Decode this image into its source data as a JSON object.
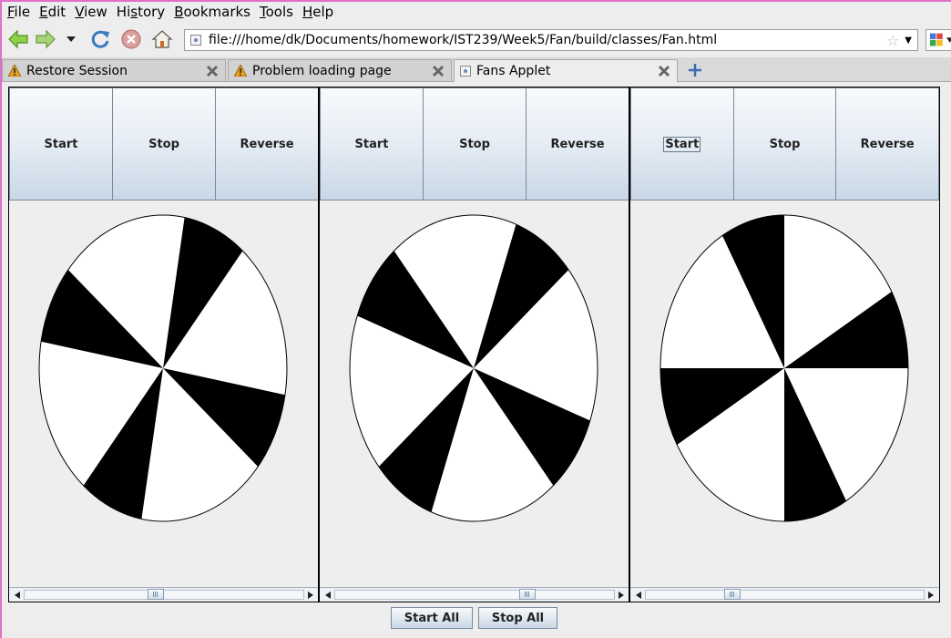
{
  "menubar": {
    "items": [
      {
        "pre": "",
        "key": "F",
        "post": "ile"
      },
      {
        "pre": "",
        "key": "E",
        "post": "dit"
      },
      {
        "pre": "",
        "key": "V",
        "post": "iew"
      },
      {
        "pre": "Hi",
        "key": "s",
        "post": "tory"
      },
      {
        "pre": "",
        "key": "B",
        "post": "ookmarks"
      },
      {
        "pre": "",
        "key": "T",
        "post": "ools"
      },
      {
        "pre": "",
        "key": "H",
        "post": "elp"
      }
    ]
  },
  "toolbar": {
    "url": "file:///home/dk/Documents/homework/IST239/Week5/Fan/build/classes/Fan.html",
    "star": "☆",
    "dropdown": "▼"
  },
  "tabs": [
    {
      "label": "Restore Session",
      "icon": "warning-icon",
      "active": false
    },
    {
      "label": "Problem loading page",
      "icon": "warning-icon",
      "active": false
    },
    {
      "label": "Fans Applet",
      "icon": "page-icon",
      "active": true
    }
  ],
  "fans": [
    {
      "buttons": {
        "start": "Start",
        "stop": "Stop",
        "reverse": "Reverse"
      },
      "rotation_deg": 100,
      "slider_value": 0.47
    },
    {
      "buttons": {
        "start": "Start",
        "stop": "Stop",
        "reverse": "Reverse"
      },
      "rotation_deg": 20,
      "slider_value": 0.7
    },
    {
      "buttons": {
        "start": "Start",
        "stop": "Stop",
        "reverse": "Reverse"
      },
      "rotation_deg": 60,
      "slider_value": 0.3
    }
  ],
  "bottom": {
    "start_all": "Start All",
    "stop_all": "Stop All"
  },
  "colors": {
    "blade": "#000000",
    "button_gradient_top": "#f8fafc",
    "button_gradient_bottom": "#c9d7e6",
    "warning": "#e8a020"
  }
}
